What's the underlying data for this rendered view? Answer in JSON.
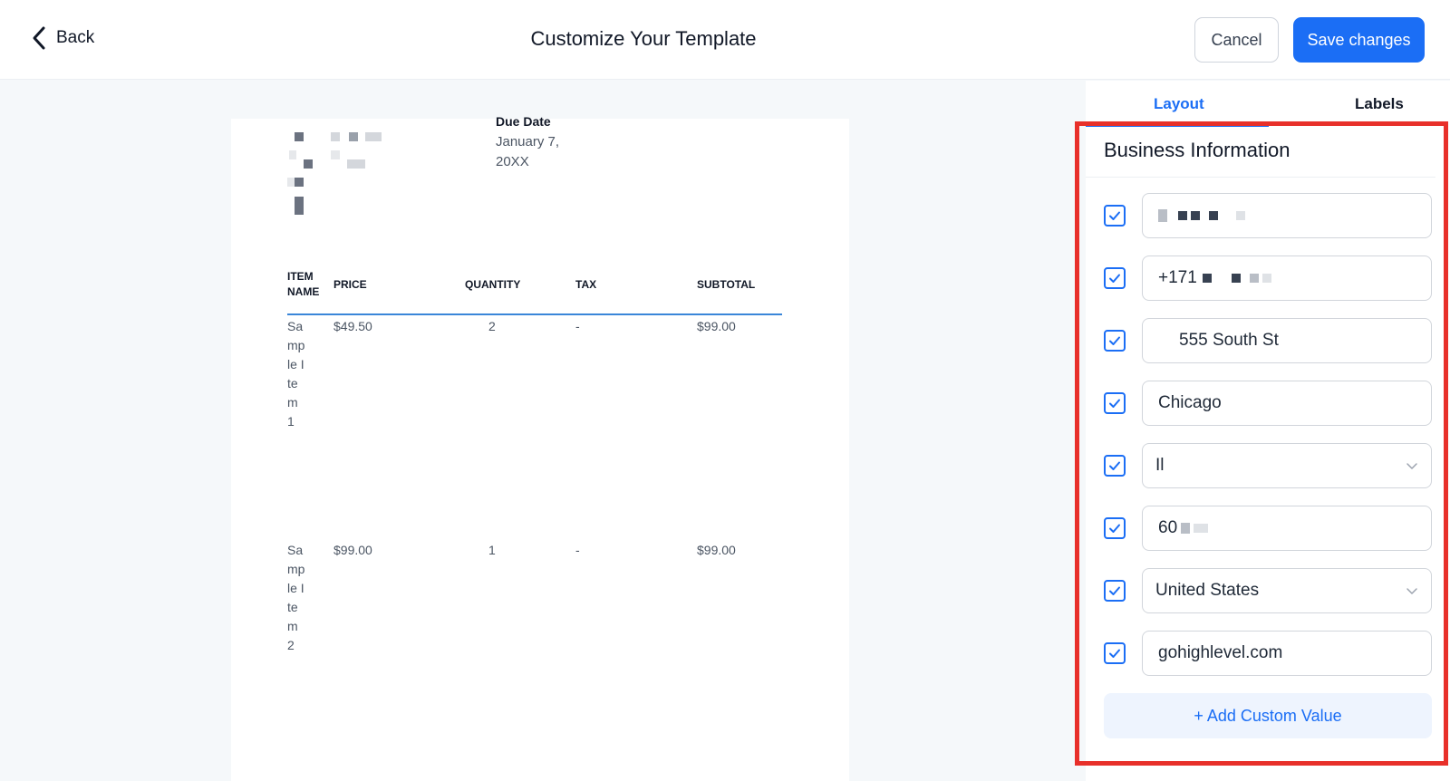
{
  "header": {
    "back_label": "Back",
    "title": "Customize Your Template",
    "cancel_label": "Cancel",
    "save_label": "Save changes"
  },
  "preview": {
    "due_date_label": "Due Date",
    "due_date_value": "January 7, 20XX",
    "columns": [
      "ITEM NAME",
      "PRICE",
      "QUANTITY",
      "TAX",
      "SUBTOTAL"
    ],
    "rows": [
      {
        "item": "Sample Item 1",
        "price": "$49.50",
        "quantity": "2",
        "tax": "-",
        "subtotal": "$99.00"
      },
      {
        "item": "Sample Item 2",
        "price": "$99.00",
        "quantity": "1",
        "tax": "-",
        "subtotal": "$99.00"
      }
    ]
  },
  "panel": {
    "tabs": [
      {
        "label": "Layout",
        "active": true
      },
      {
        "label": "Labels",
        "active": false
      }
    ],
    "section_title": "Business Information",
    "fields": [
      {
        "name": "business-name",
        "value": "",
        "checked": true,
        "type": "text"
      },
      {
        "name": "phone",
        "value": "+171",
        "checked": true,
        "type": "text"
      },
      {
        "name": "address",
        "value": "555 South St",
        "checked": true,
        "type": "text"
      },
      {
        "name": "city",
        "value": "Chicago",
        "checked": true,
        "type": "text"
      },
      {
        "name": "state",
        "value": "Il",
        "checked": true,
        "type": "select"
      },
      {
        "name": "postal-code",
        "value": "60",
        "checked": true,
        "type": "text"
      },
      {
        "name": "country",
        "value": "United States",
        "checked": true,
        "type": "select"
      },
      {
        "name": "website",
        "value": "gohighlevel.com",
        "checked": true,
        "type": "text"
      }
    ],
    "add_custom_label": "+ Add Custom Value"
  },
  "colors": {
    "accent": "#1b6ef5",
    "highlight": "#e8302a",
    "table_rule": "#3a86d9"
  },
  "icons": {
    "back": "chevron-left-icon",
    "checkbox": "checkmark-icon",
    "select": "chevron-down-icon"
  }
}
